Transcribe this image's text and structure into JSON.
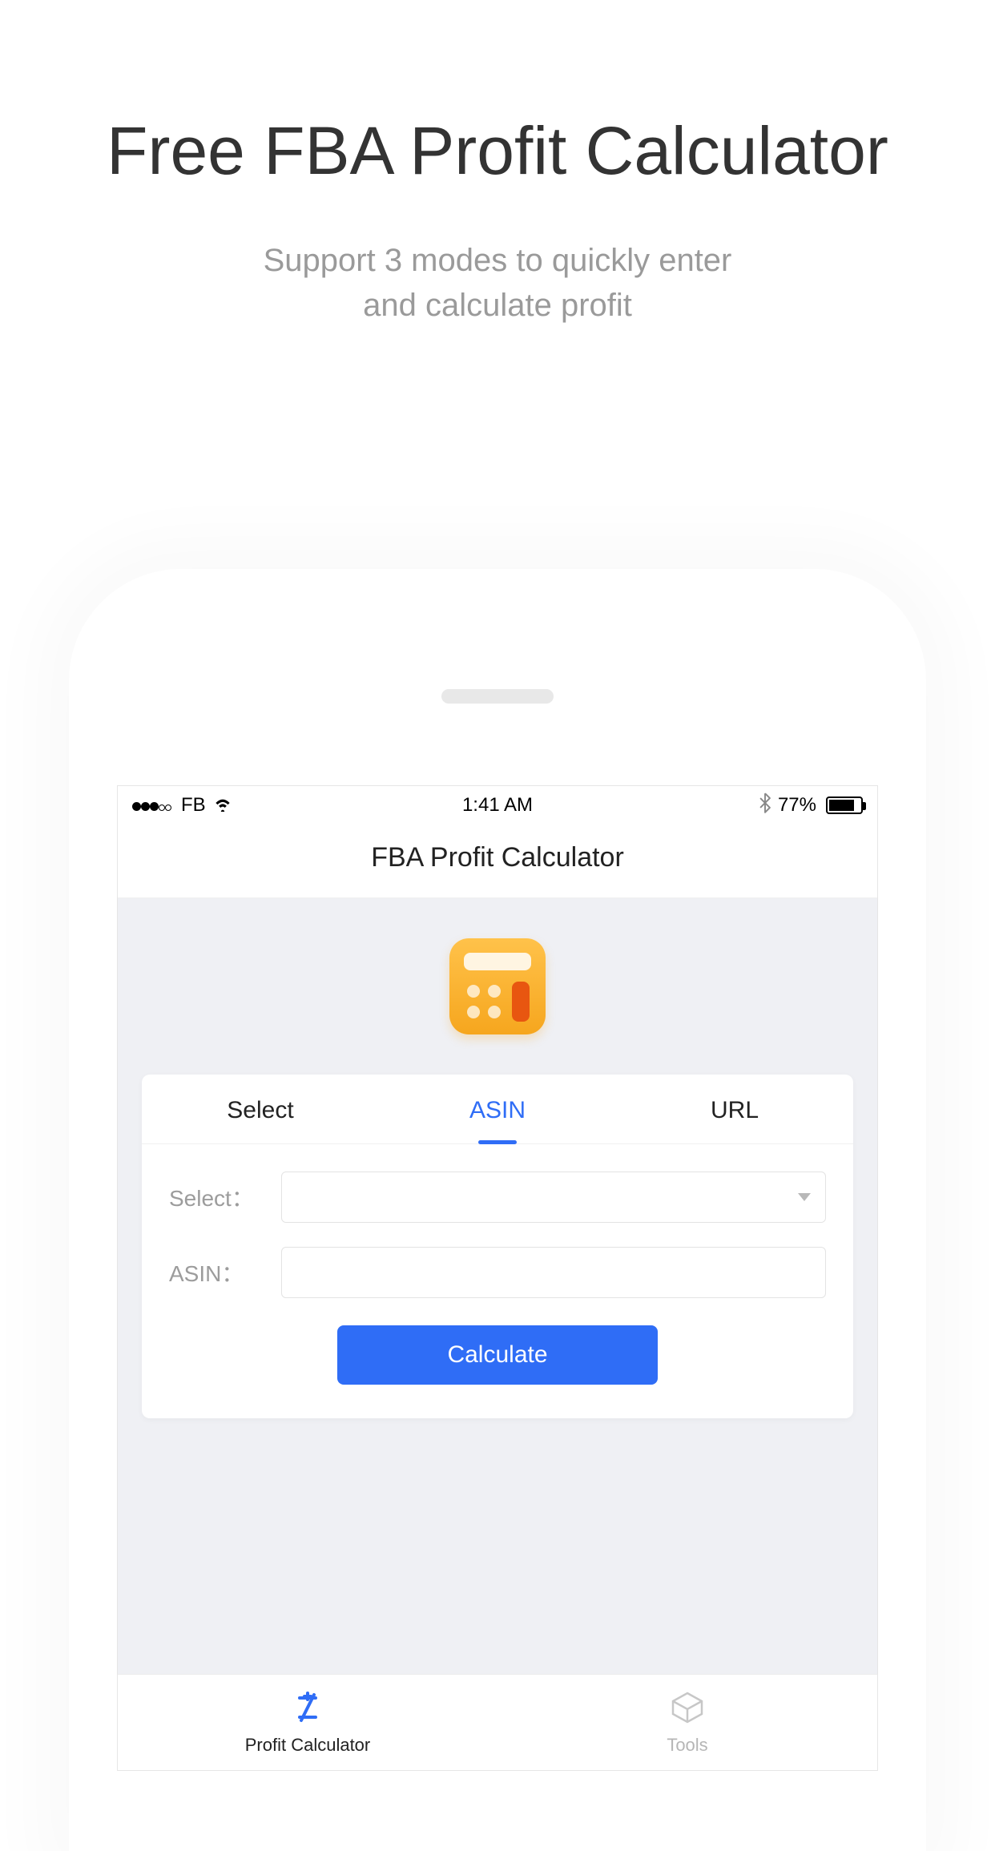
{
  "hero": {
    "title": "Free FBA Profit Calculator",
    "subtitle_line1": "Support 3 modes to quickly enter",
    "subtitle_line2": "and calculate profit"
  },
  "statusbar": {
    "carrier": "FB",
    "time": "1:41 AM",
    "battery_pct": "77%"
  },
  "nav": {
    "title": "FBA Profit Calculator"
  },
  "tabs": {
    "select": "Select",
    "asin": "ASIN",
    "url": "URL",
    "active": "asin"
  },
  "form": {
    "select_label": "Select：",
    "asin_label": "ASIN：",
    "select_value": "",
    "asin_value": "",
    "calculate_label": "Calculate"
  },
  "tabbar": {
    "profit_label": "Profit Calculator",
    "tools_label": "Tools"
  }
}
